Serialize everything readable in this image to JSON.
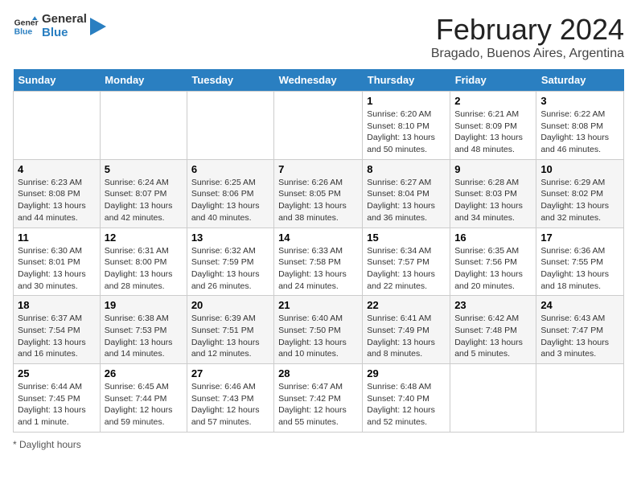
{
  "header": {
    "logo_general": "General",
    "logo_blue": "Blue",
    "title": "February 2024",
    "subtitle": "Bragado, Buenos Aires, Argentina"
  },
  "days_of_week": [
    "Sunday",
    "Monday",
    "Tuesday",
    "Wednesday",
    "Thursday",
    "Friday",
    "Saturday"
  ],
  "weeks": [
    [
      {
        "day": "",
        "info": ""
      },
      {
        "day": "",
        "info": ""
      },
      {
        "day": "",
        "info": ""
      },
      {
        "day": "",
        "info": ""
      },
      {
        "day": "1",
        "info": "Sunrise: 6:20 AM\nSunset: 8:10 PM\nDaylight: 13 hours and 50 minutes."
      },
      {
        "day": "2",
        "info": "Sunrise: 6:21 AM\nSunset: 8:09 PM\nDaylight: 13 hours and 48 minutes."
      },
      {
        "day": "3",
        "info": "Sunrise: 6:22 AM\nSunset: 8:08 PM\nDaylight: 13 hours and 46 minutes."
      }
    ],
    [
      {
        "day": "4",
        "info": "Sunrise: 6:23 AM\nSunset: 8:08 PM\nDaylight: 13 hours and 44 minutes."
      },
      {
        "day": "5",
        "info": "Sunrise: 6:24 AM\nSunset: 8:07 PM\nDaylight: 13 hours and 42 minutes."
      },
      {
        "day": "6",
        "info": "Sunrise: 6:25 AM\nSunset: 8:06 PM\nDaylight: 13 hours and 40 minutes."
      },
      {
        "day": "7",
        "info": "Sunrise: 6:26 AM\nSunset: 8:05 PM\nDaylight: 13 hours and 38 minutes."
      },
      {
        "day": "8",
        "info": "Sunrise: 6:27 AM\nSunset: 8:04 PM\nDaylight: 13 hours and 36 minutes."
      },
      {
        "day": "9",
        "info": "Sunrise: 6:28 AM\nSunset: 8:03 PM\nDaylight: 13 hours and 34 minutes."
      },
      {
        "day": "10",
        "info": "Sunrise: 6:29 AM\nSunset: 8:02 PM\nDaylight: 13 hours and 32 minutes."
      }
    ],
    [
      {
        "day": "11",
        "info": "Sunrise: 6:30 AM\nSunset: 8:01 PM\nDaylight: 13 hours and 30 minutes."
      },
      {
        "day": "12",
        "info": "Sunrise: 6:31 AM\nSunset: 8:00 PM\nDaylight: 13 hours and 28 minutes."
      },
      {
        "day": "13",
        "info": "Sunrise: 6:32 AM\nSunset: 7:59 PM\nDaylight: 13 hours and 26 minutes."
      },
      {
        "day": "14",
        "info": "Sunrise: 6:33 AM\nSunset: 7:58 PM\nDaylight: 13 hours and 24 minutes."
      },
      {
        "day": "15",
        "info": "Sunrise: 6:34 AM\nSunset: 7:57 PM\nDaylight: 13 hours and 22 minutes."
      },
      {
        "day": "16",
        "info": "Sunrise: 6:35 AM\nSunset: 7:56 PM\nDaylight: 13 hours and 20 minutes."
      },
      {
        "day": "17",
        "info": "Sunrise: 6:36 AM\nSunset: 7:55 PM\nDaylight: 13 hours and 18 minutes."
      }
    ],
    [
      {
        "day": "18",
        "info": "Sunrise: 6:37 AM\nSunset: 7:54 PM\nDaylight: 13 hours and 16 minutes."
      },
      {
        "day": "19",
        "info": "Sunrise: 6:38 AM\nSunset: 7:53 PM\nDaylight: 13 hours and 14 minutes."
      },
      {
        "day": "20",
        "info": "Sunrise: 6:39 AM\nSunset: 7:51 PM\nDaylight: 13 hours and 12 minutes."
      },
      {
        "day": "21",
        "info": "Sunrise: 6:40 AM\nSunset: 7:50 PM\nDaylight: 13 hours and 10 minutes."
      },
      {
        "day": "22",
        "info": "Sunrise: 6:41 AM\nSunset: 7:49 PM\nDaylight: 13 hours and 8 minutes."
      },
      {
        "day": "23",
        "info": "Sunrise: 6:42 AM\nSunset: 7:48 PM\nDaylight: 13 hours and 5 minutes."
      },
      {
        "day": "24",
        "info": "Sunrise: 6:43 AM\nSunset: 7:47 PM\nDaylight: 13 hours and 3 minutes."
      }
    ],
    [
      {
        "day": "25",
        "info": "Sunrise: 6:44 AM\nSunset: 7:45 PM\nDaylight: 13 hours and 1 minute."
      },
      {
        "day": "26",
        "info": "Sunrise: 6:45 AM\nSunset: 7:44 PM\nDaylight: 12 hours and 59 minutes."
      },
      {
        "day": "27",
        "info": "Sunrise: 6:46 AM\nSunset: 7:43 PM\nDaylight: 12 hours and 57 minutes."
      },
      {
        "day": "28",
        "info": "Sunrise: 6:47 AM\nSunset: 7:42 PM\nDaylight: 12 hours and 55 minutes."
      },
      {
        "day": "29",
        "info": "Sunrise: 6:48 AM\nSunset: 7:40 PM\nDaylight: 12 hours and 52 minutes."
      },
      {
        "day": "",
        "info": ""
      },
      {
        "day": "",
        "info": ""
      }
    ]
  ],
  "footer": {
    "note": "Daylight hours"
  }
}
